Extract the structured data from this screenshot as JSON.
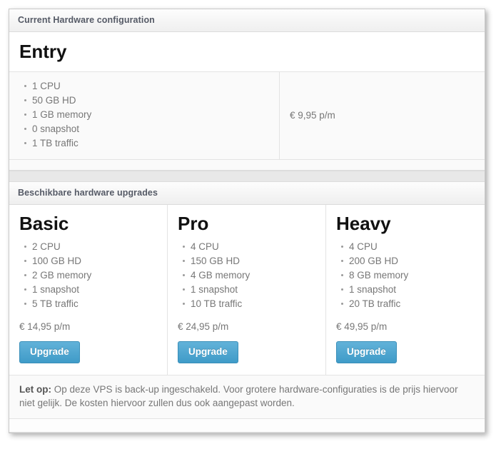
{
  "current_panel": {
    "heading": "Current Hardware configuration",
    "plan": {
      "name": "Entry",
      "specs": [
        "1 CPU",
        "50 GB HD",
        "1 GB memory",
        "0 snapshot",
        "1 TB traffic"
      ],
      "price": "€ 9,95 p/m"
    }
  },
  "upgrades_panel": {
    "heading": "Beschikbare hardware upgrades",
    "plans": [
      {
        "name": "Basic",
        "specs": [
          "2 CPU",
          "100 GB HD",
          "2 GB memory",
          "1 snapshot",
          "5 TB traffic"
        ],
        "price": "€ 14,95 p/m",
        "button_label": "Upgrade"
      },
      {
        "name": "Pro",
        "specs": [
          "4 CPU",
          "150 GB HD",
          "4 GB memory",
          "1 snapshot",
          "10 TB traffic"
        ],
        "price": "€ 24,95 p/m",
        "button_label": "Upgrade"
      },
      {
        "name": "Heavy",
        "specs": [
          "4 CPU",
          "200 GB HD",
          "8 GB memory",
          "1 snapshot",
          "20 TB traffic"
        ],
        "price": "€ 49,95 p/m",
        "button_label": "Upgrade"
      }
    ]
  },
  "note": {
    "label": "Let op:",
    "text": "Op deze VPS is back-up ingeschakeld. Voor grotere hardware-configuraties is de prijs hiervoor niet gelijk. De kosten hiervoor zullen dus ook aangepast worden."
  },
  "colors": {
    "button_accent": "#4fa3cc",
    "heading_text": "#555a66",
    "body_text": "#777777"
  }
}
